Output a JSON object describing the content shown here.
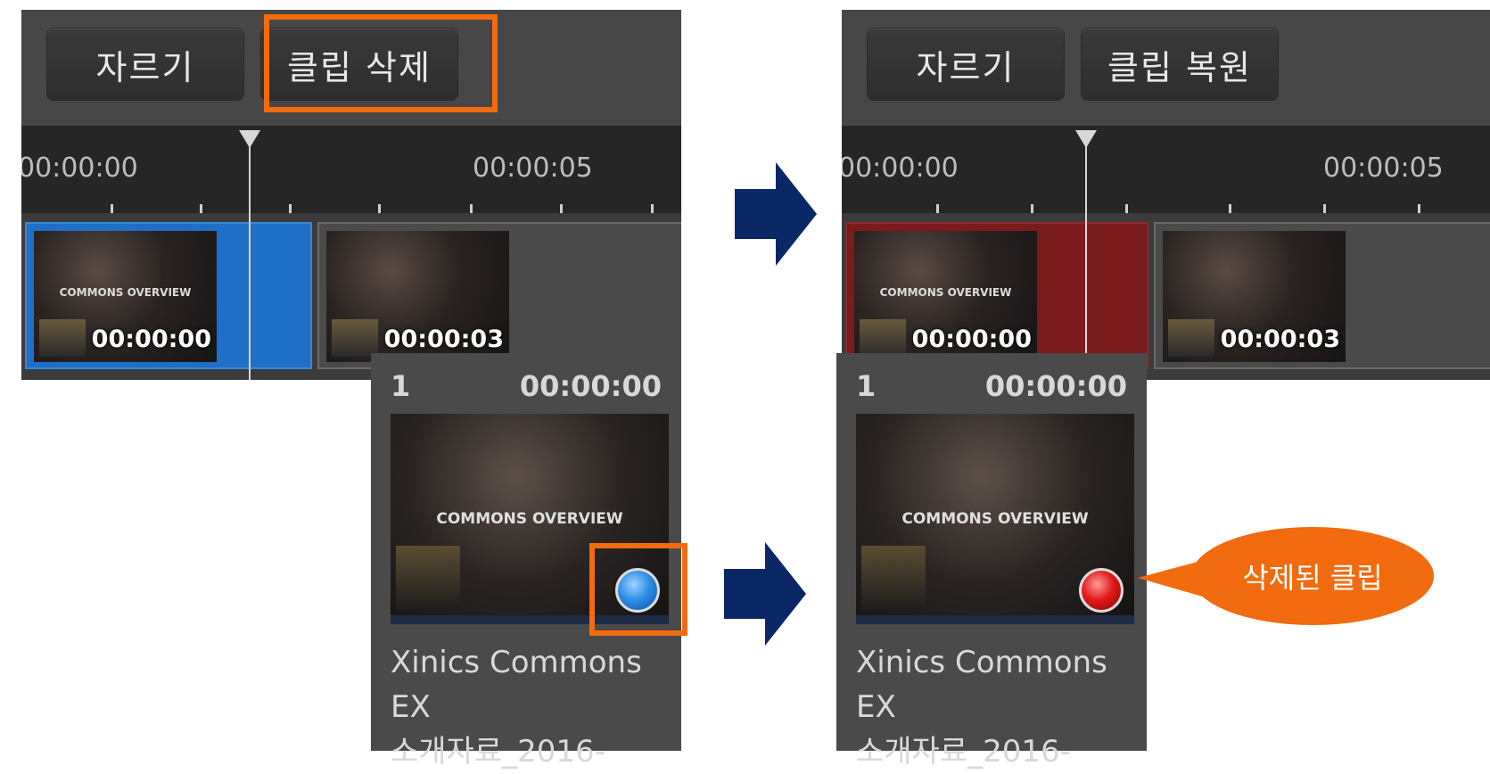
{
  "before": {
    "toolbar": {
      "cut_label": "자르기",
      "delete_label": "클립 삭제"
    },
    "ruler": {
      "start": "00:00:00",
      "mark": "00:00:05"
    },
    "clips": [
      {
        "time": "00:00:00",
        "title": "COMMONS OVERVIEW"
      },
      {
        "time": "00:00:03"
      }
    ],
    "card": {
      "index": "1",
      "time": "00:00:00",
      "title_line1": "Xinics Commons EX",
      "title_line2": "소개자료_2016-",
      "thumb_title": "COMMONS OVERVIEW"
    }
  },
  "after": {
    "toolbar": {
      "cut_label": "자르기",
      "restore_label": "클립 복원"
    },
    "ruler": {
      "start": "00:00:00",
      "mark": "00:00:05"
    },
    "clips": [
      {
        "time": "00:00:00",
        "title": "COMMONS OVERVIEW"
      },
      {
        "time": "00:00:03"
      }
    ],
    "card": {
      "index": "1",
      "time": "00:00:00",
      "title_line1": "Xinics Commons EX",
      "title_line2": "소개자료_2016-",
      "thumb_title": "COMMONS OVERVIEW"
    },
    "callout": "삭제된 클립"
  },
  "colors": {
    "highlight": "#f26b0f",
    "arrow": "#0a2766",
    "selected_clip": "#1f6fc6",
    "deleted_clip": "#7a1c1c"
  },
  "icons": {
    "active_status": "blue-circle-icon",
    "deleted_status": "red-circle-icon",
    "transition": "right-arrow-icon",
    "playhead": "playhead-marker-icon"
  }
}
